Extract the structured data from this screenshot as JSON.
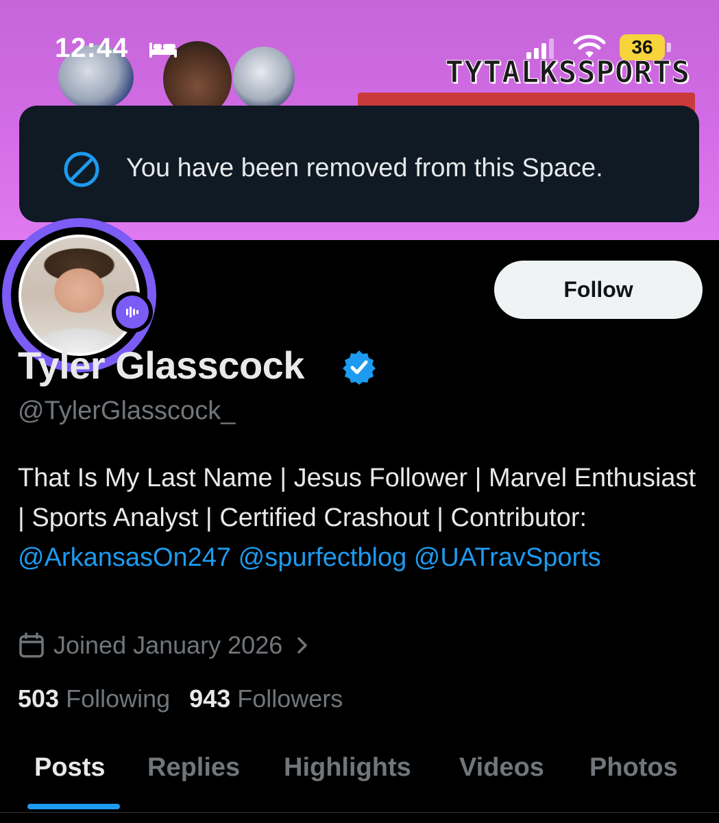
{
  "status_bar": {
    "time": "12:44",
    "battery_level": "36",
    "battery_color": "#f7d33c",
    "icons": [
      "bed-icon",
      "cellular-signal-icon",
      "wifi-icon",
      "battery-icon"
    ]
  },
  "banner": {
    "brand_text": "TYTALKSSPORTS",
    "gradient_colors": [
      "#c565d8",
      "#e07af0"
    ]
  },
  "toast": {
    "icon": "blocked-icon",
    "message": "You have been removed from this Space."
  },
  "profile": {
    "display_name": "Tyler Glasscock",
    "verified": true,
    "handle": "@TylerGlasscock_",
    "bio": {
      "text_1": "That Is My Last Name | Jesus Follower | Marvel Enthusiast | Sports Analyst | Certified Crashout | Contributor: ",
      "mentions": [
        "@ArkansasOn247",
        "@spurfectblog",
        "@UATravSports"
      ]
    },
    "joined": "Joined January 2026",
    "following_count": "503",
    "following_label": "Following",
    "followers_count": "943",
    "followers_label": "Followers",
    "follow_button_label": "Follow",
    "avatar_ring_color": "#7b5cf5"
  },
  "tabs": [
    {
      "label": "Posts",
      "active": true
    },
    {
      "label": "Replies",
      "active": false
    },
    {
      "label": "Highlights",
      "active": false
    },
    {
      "label": "Videos",
      "active": false
    },
    {
      "label": "Photos",
      "active": false
    }
  ],
  "colors": {
    "accent": "#1d9bf0",
    "background": "#000000",
    "text_primary": "#e7e9ea",
    "text_secondary": "#71767b",
    "toast_bg": "#0f1a24"
  }
}
